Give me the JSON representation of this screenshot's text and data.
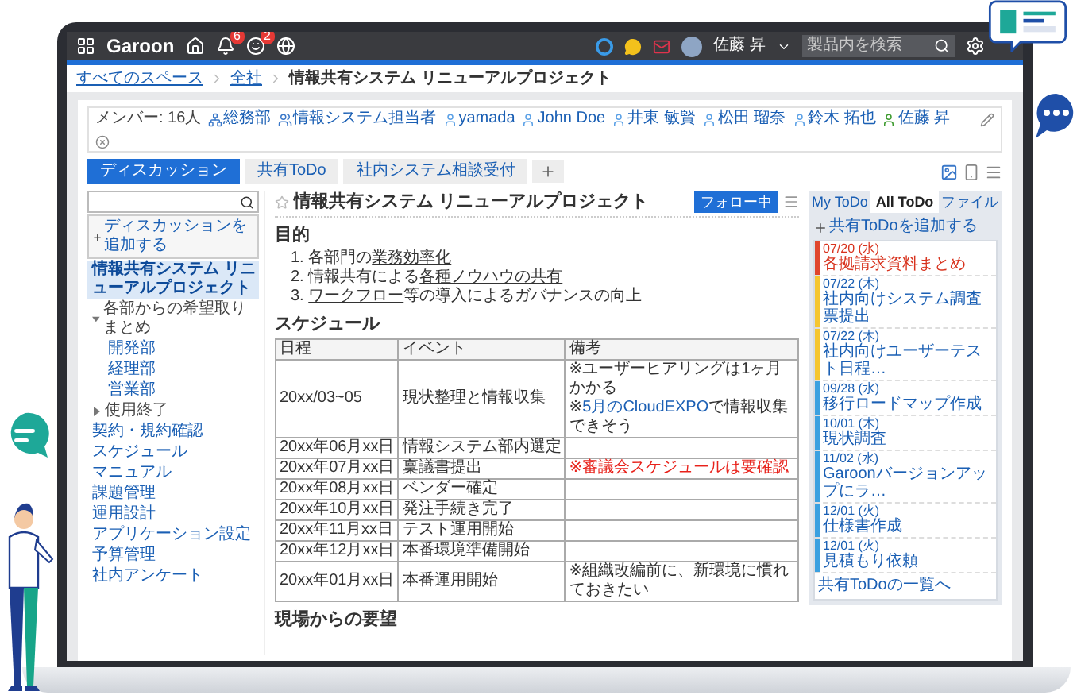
{
  "top_bar": {
    "logo": "Garoon",
    "notifications": [
      {
        "kind": "bell",
        "badge": "6"
      },
      {
        "kind": "face",
        "badge": "2"
      }
    ],
    "user": "佐藤 昇",
    "search": {
      "placeholder": "製品内を検索"
    }
  },
  "breadcrumb": [
    "すべてのスペース",
    "全社",
    "情報共有システム リニューアルプロジェクト"
  ],
  "members": {
    "label": "メンバー: 16人",
    "items": [
      {
        "name": "総務部",
        "kind": "org"
      },
      {
        "name": "情報システム担当者",
        "kind": "group"
      },
      {
        "name": "yamada",
        "kind": "user"
      },
      {
        "name": "John Doe",
        "kind": "user"
      },
      {
        "name": "井東 敏賢",
        "kind": "user"
      },
      {
        "name": "松田 瑠奈",
        "kind": "user"
      },
      {
        "name": "鈴木 拓也",
        "kind": "user"
      },
      {
        "name": "佐藤 昇",
        "kind": "self"
      }
    ]
  },
  "tabs": [
    {
      "label": "ディスカッション",
      "selected": true
    },
    {
      "label": "共有ToDo",
      "selected": false
    },
    {
      "label": "社内システム相談受付",
      "selected": false
    }
  ],
  "sidebar": {
    "add_button": "ディスカッションを追加する",
    "items": [
      {
        "label": "情報共有システム リニューアルプロジェクト",
        "selected": true
      },
      {
        "label": "各部からの希望取りまとめ",
        "selected": false,
        "expanded": true,
        "children": [
          {
            "label": "開発部",
            "selected": false
          },
          {
            "label": "経理部",
            "selected": false
          },
          {
            "label": "営業部",
            "selected": false
          }
        ]
      },
      {
        "label": "使用終了",
        "selected": false,
        "expanded": false
      },
      {
        "label": "契約・規約確認",
        "selected": false
      },
      {
        "label": "スケジュール",
        "selected": false
      },
      {
        "label": "マニュアル",
        "selected": false
      },
      {
        "label": "課題管理",
        "selected": false
      },
      {
        "label": "運用設計",
        "selected": false
      },
      {
        "label": "アプリケーション設定",
        "selected": false
      },
      {
        "label": "予算管理",
        "selected": false
      },
      {
        "label": "社内アンケート",
        "selected": false
      }
    ]
  },
  "discussion": {
    "title": "情報共有システム リニューアルプロジェクト",
    "follow": "フォロー中",
    "purpose": {
      "heading": "目的",
      "items": [
        {
          "number": "1.",
          "parts": [
            {
              "text": "各部門の",
              "kind": "plain"
            },
            {
              "text": "業務効率化",
              "kind": "underline"
            }
          ]
        },
        {
          "number": "2.",
          "parts": [
            {
              "text": "情報共有による",
              "kind": "plain"
            },
            {
              "text": "各種ノウハウの共有",
              "kind": "underline"
            }
          ]
        },
        {
          "number": "3.",
          "parts": [
            {
              "text": "ワークフロー",
              "kind": "underline"
            },
            {
              "text": "等の導入によるガバナンスの向上",
              "kind": "plain"
            }
          ]
        }
      ]
    },
    "schedule": {
      "heading": "スケジュール",
      "columns": [
        "日程",
        "イベント",
        "備考"
      ],
      "rows": [
        {
          "date": "20xx/03~05",
          "event": "現状整理と情報収集",
          "notes": [
            [
              {
                "text": "※ユーザーヒアリングは1ヶ月かかる",
                "kind": "plain"
              }
            ],
            [
              {
                "text": "※",
                "kind": "plain"
              },
              {
                "text": "5月のCloudEXPO",
                "kind": "link"
              },
              {
                "text": "で情報収集できそう",
                "kind": "plain"
              }
            ]
          ]
        },
        {
          "date": "20xx年06月xx日",
          "event": "情報システム部内選定",
          "notes": []
        },
        {
          "date": "20xx年07月xx日",
          "event": "稟議書提出",
          "notes": [
            [
              {
                "text": "※審議会スケジュールは要確認",
                "kind": "alert"
              }
            ]
          ]
        },
        {
          "date": "20xx年08月xx日",
          "event": "ベンダー確定",
          "notes": []
        },
        {
          "date": "20xx年10月xx日",
          "event": "発注手続き完了",
          "notes": []
        },
        {
          "date": "20xx年11月xx日",
          "event": "テスト運用開始",
          "notes": []
        },
        {
          "date": "20xx年12月xx日",
          "event": "本番環境準備開始",
          "notes": []
        },
        {
          "date": "20xx年01月xx日",
          "event": "本番運用開始",
          "notes": [
            [
              {
                "text": "※組織改編前に、新環境に慣れておきたい",
                "kind": "plain"
              }
            ]
          ]
        }
      ]
    },
    "requests": {
      "heading": "現場からの要望"
    }
  },
  "todo_panel": {
    "tabs": [
      {
        "label": "My ToDo",
        "selected": false
      },
      {
        "label": "All ToDo",
        "selected": true
      },
      {
        "label": "ファイル",
        "selected": false
      }
    ],
    "add": "共有ToDoを追加する",
    "items": [
      {
        "date": "07/20 (水)",
        "title": "各拠請求資料まとめ",
        "color": "#e0452b",
        "overdue": true
      },
      {
        "date": "07/22 (木)",
        "title": "社内向けシステム調査票提出",
        "color": "#f5c630",
        "overdue": false
      },
      {
        "date": "07/22 (木)",
        "title": "社内向けユーザーテスト日程…",
        "color": "#f5c630",
        "overdue": false
      },
      {
        "date": "09/28 (水)",
        "title": "移行ロードマップ作成",
        "color": "#3aa0e0",
        "overdue": false
      },
      {
        "date": "10/01 (木)",
        "title": "現状調査",
        "color": "#3aa0e0",
        "overdue": false
      },
      {
        "date": "11/02 (水)",
        "title": "Garoonバージョンアップにラ…",
        "color": "#3aa0e0",
        "overdue": false
      },
      {
        "date": "12/01 (火)",
        "title": "仕様書作成",
        "color": "#3aa0e0",
        "overdue": false
      },
      {
        "date": "12/01 (火)",
        "title": "見積もり依頼",
        "color": "#3aa0e0",
        "overdue": false
      }
    ],
    "footer": "共有ToDoの一覧へ"
  }
}
